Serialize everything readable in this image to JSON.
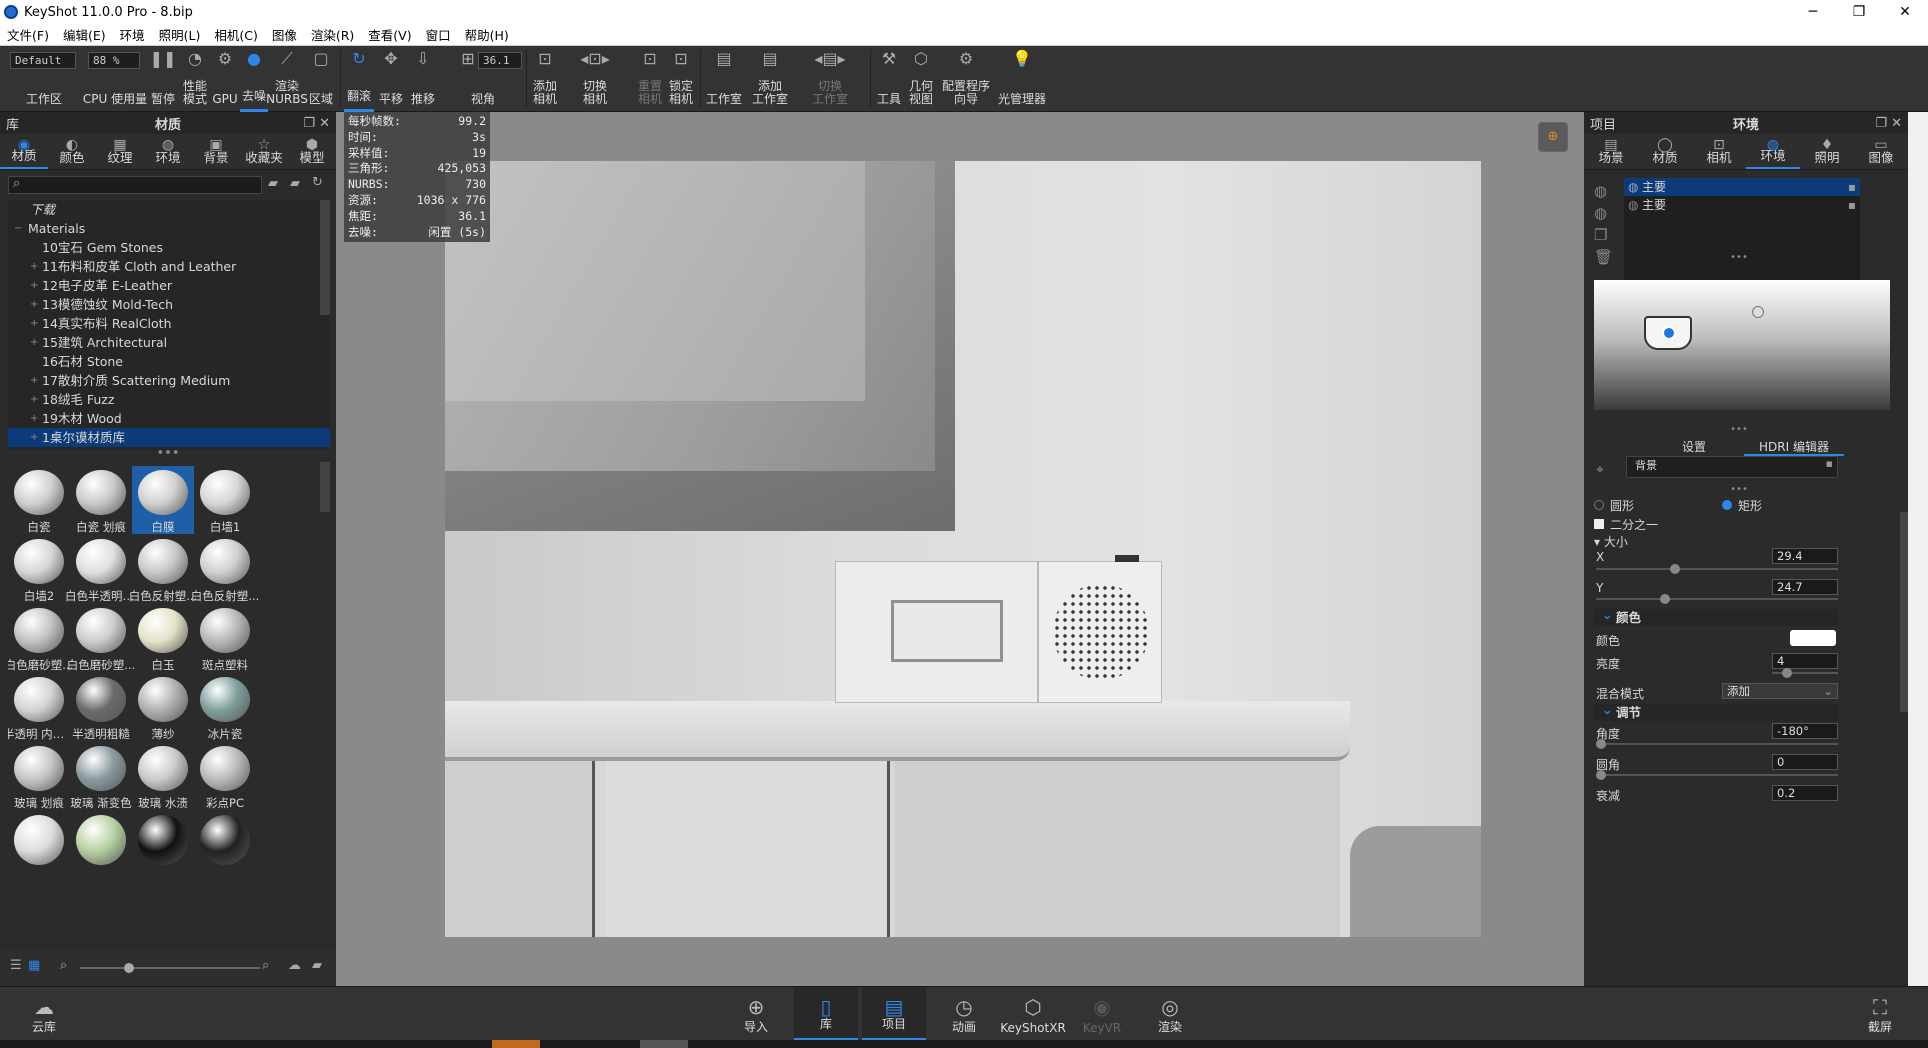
{
  "window": {
    "title": "KeyShot 11.0.0 Pro  - 8.bip",
    "min": "─",
    "max": "❐",
    "close": "✕"
  },
  "menu": [
    "文件(F)",
    "编辑(E)",
    "环境",
    "照明(L)",
    "相机(C)",
    "图像",
    "渲染(R)",
    "查看(V)",
    "窗口",
    "帮助(H)"
  ],
  "toolbar": {
    "workspace_value": "Default",
    "workspace_label": "工作区",
    "cpu_value": "88 %",
    "cpu_label": "CPU 使用量",
    "pause": "暂停",
    "perf": "性能\n模式",
    "gpu": "GPU",
    "denoise": "去噪",
    "nurbs": "渲染\nNURBS",
    "region": "区域",
    "tumble": "翻滚",
    "pan": "平移",
    "dolly": "推移",
    "fov_value": "36.1",
    "fov_label": "视角",
    "add_camera": "添加\n相机",
    "switch_camera": "切换\n相机",
    "reset_camera": "重置\n相机",
    "lock_camera": "锁定\n相机",
    "studio": "工作室",
    "add_studio": "添加\n工作室",
    "switch_studio": "切换\n工作室",
    "tools": "工具",
    "geometry_view": "几何\n视图",
    "config_wizard": "配置程序\n向导",
    "light_manager": "光管理器"
  },
  "library": {
    "header_left": "库",
    "header_title": "材质",
    "tabs": [
      "材质",
      "颜色",
      "纹理",
      "环境",
      "背景",
      "收藏夹",
      "模型"
    ],
    "search_placeholder": "",
    "tree": [
      "下载",
      "Materials",
      "10宝石 Gem Stones",
      "11布料和皮革 Cloth and Leather",
      "12电子皮革 E-Leather",
      "13模德蚀纹 Mold-Tech",
      "14真实布料 RealCloth",
      "15建筑 Architectural",
      "16石材 Stone",
      "17散射介质 Scattering Medium",
      "18绒毛 Fuzz",
      "19木材 Wood",
      "1桌尔谟材质库"
    ],
    "thumbs": [
      "白瓷",
      "白瓷 划痕",
      "白膜",
      "白墙1",
      "白墙2",
      "白色半透明 ...",
      "白色反射塑...",
      "白色反射塑...",
      "白色磨砂塑...",
      "白色磨砂塑...",
      "白玉",
      "斑点塑料",
      "半透明 内部...",
      "半透明粗糙",
      "薄纱",
      "冰片瓷",
      "玻璃 划痕",
      "玻璃 渐变色",
      "玻璃 水渍",
      "彩点PC",
      "",
      "",
      "",
      ""
    ]
  },
  "hud": [
    [
      "每秒帧数:",
      "99.2"
    ],
    [
      "时间:",
      "3s"
    ],
    [
      "采样值:",
      "19"
    ],
    [
      "三角形:",
      "425,053"
    ],
    [
      "NURBS:",
      "730"
    ],
    [
      "资源:",
      "1036 x 776"
    ],
    [
      "焦距:",
      "36.1"
    ],
    [
      "去噪:",
      "闲置 (5s)"
    ]
  ],
  "project": {
    "header_left": "项目",
    "header_title": "环境",
    "tabs": [
      "场景",
      "材质",
      "相机",
      "环境",
      "照明",
      "图像"
    ],
    "env_list": [
      "主要",
      "主要"
    ],
    "subtabs": [
      "设置",
      "HDRI 编辑器"
    ],
    "bg_label": "背景",
    "shape_circle": "圆形",
    "shape_rect": "矩形",
    "half": "二分之一",
    "size_label": "大小",
    "x_label": "X",
    "x_value": "29.4",
    "y_label": "Y",
    "y_value": "24.7",
    "color_section": "颜色",
    "color_label": "颜色",
    "brightness_label": "亮度",
    "brightness_value": "4",
    "blend_label": "混合模式",
    "blend_value": "添加",
    "adjust_section": "调节",
    "angle_label": "角度",
    "angle_value": "-180°",
    "round_label": "圆角",
    "round_value": "0",
    "falloff_label": "衰减",
    "falloff_value": "0.2"
  },
  "bottom": [
    "云库",
    "导入",
    "库",
    "项目",
    "动画",
    "KeyShotXR",
    "KeyVR",
    "渲染",
    "截屏"
  ],
  "colors": {
    "accent": "#2b88e8",
    "selection": "#0d3a78"
  }
}
